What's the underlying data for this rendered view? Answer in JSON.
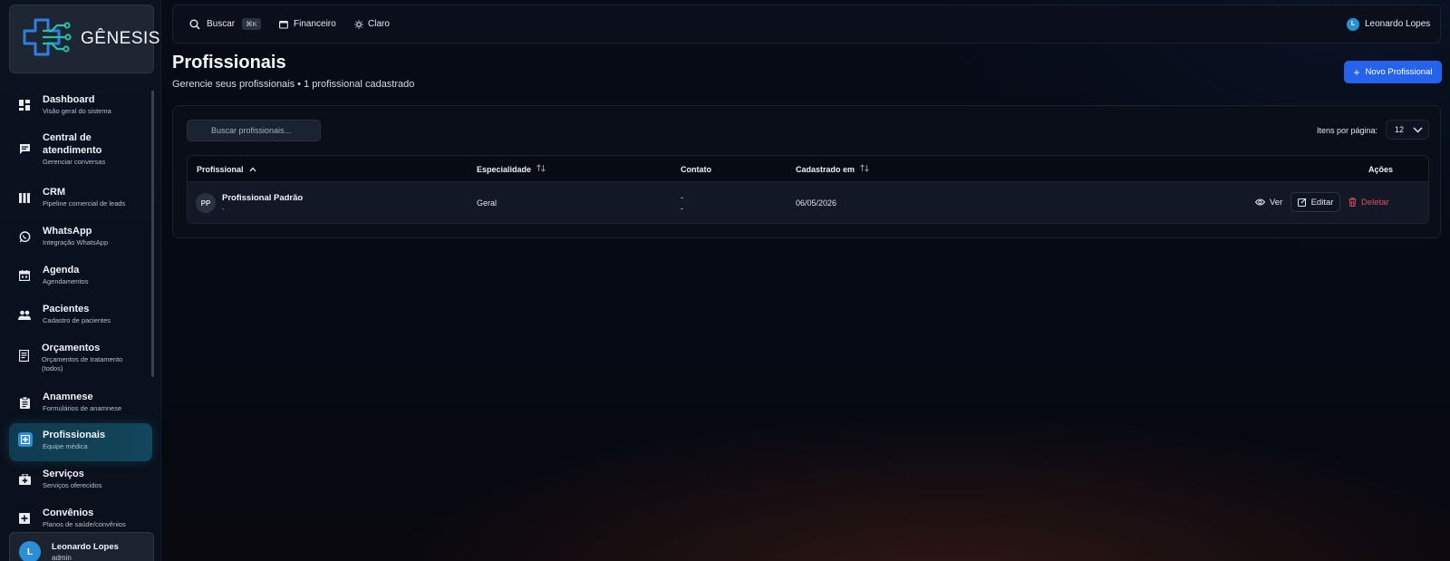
{
  "app": {
    "name": "GÊNESIS"
  },
  "sidebar": {
    "items": [
      {
        "label": "Dashboard",
        "sub": "Visão geral do sistema",
        "icon": "dashboard-icon"
      },
      {
        "label": "Central de atendimento",
        "sub": "Gerenciar conversas",
        "icon": "chat-icon"
      },
      {
        "label": "CRM",
        "sub": "Pipeline comercial de leads",
        "icon": "kanban-icon"
      },
      {
        "label": "WhatsApp",
        "sub": "Integração WhatsApp",
        "icon": "whatsapp-icon"
      },
      {
        "label": "Agenda",
        "sub": "Agendamentos",
        "icon": "calendar-icon"
      },
      {
        "label": "Pacientes",
        "sub": "Cadastro de pacientes",
        "icon": "people-icon"
      },
      {
        "label": "Orçamentos",
        "sub": "Orçamentos de tratamento (todos)",
        "icon": "receipt-icon"
      },
      {
        "label": "Anamnese",
        "sub": "Formulários de anamnese",
        "icon": "clipboard-icon"
      },
      {
        "label": "Profissionais",
        "sub": "Equipe médica",
        "icon": "medical-icon",
        "active": true
      },
      {
        "label": "Serviços",
        "sub": "Serviços oferecidos",
        "icon": "medkit-icon"
      },
      {
        "label": "Convênios",
        "sub": "Planos de saúde/convênios",
        "icon": "plus-box-icon"
      }
    ],
    "user": {
      "initial": "L",
      "name": "Leonardo Lopes",
      "role": "admin"
    }
  },
  "topbar": {
    "search_label": "Buscar",
    "search_shortcut": "⌘K",
    "finance_label": "Financeiro",
    "theme_label": "Claro",
    "user_initial": "L",
    "user_name": "Leonardo Lopes"
  },
  "page": {
    "title": "Profissionais",
    "subtitle": "Gerencie seus profissionais • 1 profissional cadastrado",
    "new_button": "Novo Profissional"
  },
  "panel": {
    "search_placeholder": "Buscar profissionais...",
    "per_page_label": "Itens por página:",
    "per_page_value": "12"
  },
  "table": {
    "columns": [
      "Profissional",
      "Especialidade",
      "Contato",
      "Cadastrado em",
      "Ações"
    ],
    "rows": [
      {
        "initials": "PP",
        "name": "Profissional Padrão",
        "detail": "-",
        "specialty": "Geral",
        "contact_1": "-",
        "contact_2": "-",
        "created": "06/05/2026",
        "actions": {
          "view": "Ver",
          "edit": "Editar",
          "delete": "Deletar"
        }
      }
    ]
  },
  "colors": {
    "primary": "#2563eb",
    "danger": "#e2505a",
    "active_nav": "#12465a",
    "avatar": "#2a8fd6"
  }
}
